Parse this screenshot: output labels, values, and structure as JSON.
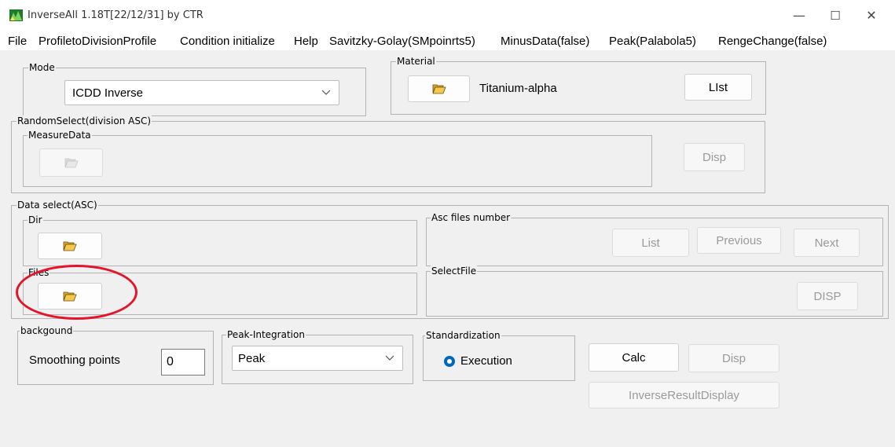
{
  "window": {
    "title": "InverseAll 1.18T[22/12/31] by CTR",
    "minimize_glyph": "—",
    "maximize_glyph": "☐",
    "close_glyph": "✕"
  },
  "menu": [
    "File",
    "ProfiletoDivisionProfile",
    "Condition initialize",
    "Help",
    "Savitzky-Golay(SMpoinrts5)",
    "MinusData(false)",
    "Peak(Palabola5)",
    "RengeChange(false)"
  ],
  "mode": {
    "label": "Mode",
    "selected": "ICDD Inverse"
  },
  "material": {
    "label": "Material",
    "name": "Titanium-alpha",
    "list_button": "LIst"
  },
  "random_select": {
    "label": "RandomSelect(division ASC)",
    "measure_label": "MeasureData",
    "disp_button": "Disp"
  },
  "data_select": {
    "label": "Data select(ASC)",
    "dir_label": "Dir",
    "files_label": "Files",
    "asc_number_label": "Asc files number",
    "list_button": "List",
    "previous_button": "Previous",
    "next_button": "Next",
    "select_file_label": "SelectFile",
    "disp_button": "DISP"
  },
  "background": {
    "label": "backgound",
    "smoothing_label": "Smoothing points",
    "smoothing_value": "0"
  },
  "peak_integration": {
    "label": "Peak-Integration",
    "selected": "Peak"
  },
  "standardization": {
    "label": "Standardization",
    "option": "Execution"
  },
  "actions": {
    "calc": "Calc",
    "disp": "Disp",
    "inverse_result": "InverseResultDisplay"
  },
  "colors": {
    "annotation": "#e5142a",
    "radio_accent": "#0067c0",
    "folder_yellow": "#f5c84c"
  },
  "icons": [
    "app-icon",
    "folder-open-icon",
    "chevron-down-icon"
  ]
}
